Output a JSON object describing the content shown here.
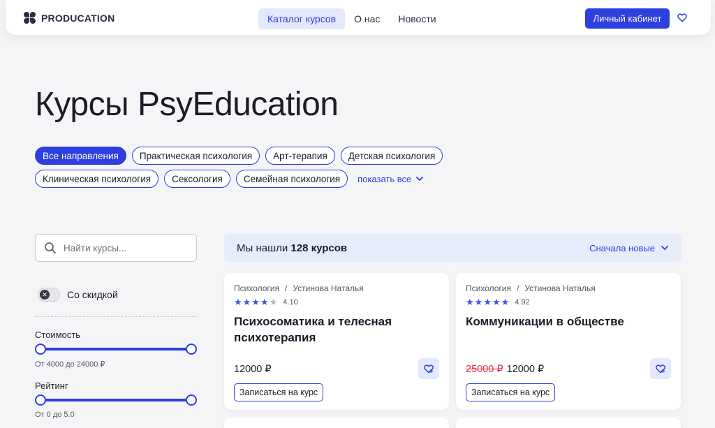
{
  "header": {
    "logo_text": "PRODUCATION",
    "nav": [
      {
        "label": "Каталог курсов",
        "active": true
      },
      {
        "label": "О нас",
        "active": false
      },
      {
        "label": "Новости",
        "active": false
      }
    ],
    "cabinet_label": "Личный кабинет",
    "accent_color": "#2e3fe0"
  },
  "page_title": "Курсы PsyEducation",
  "tags_row1": [
    {
      "label": "Все направления",
      "active": true
    },
    {
      "label": "Практическая психология",
      "active": false
    },
    {
      "label": "Арт-терапия",
      "active": false
    },
    {
      "label": "Детская психология",
      "active": false
    }
  ],
  "tags_row2": [
    {
      "label": "Клиническая психология",
      "active": false
    },
    {
      "label": "Сексология",
      "active": false
    },
    {
      "label": "Семейная психология",
      "active": false
    }
  ],
  "show_all_label": "показать все",
  "sidebar": {
    "search_placeholder": "Найти курсы...",
    "discount_label": "Со скидкой",
    "discount_on": false,
    "price_label": "Стоимость",
    "price_range": "От 4000 до 24000 ₽",
    "rating_label": "Рейтинг",
    "rating_range": "От 0 до 5.0"
  },
  "results": {
    "count_prefix": "Мы нашли",
    "count_value": "128 курсов",
    "sort_label": "Сначала новые"
  },
  "cards": [
    {
      "category": "Психология",
      "separator": "/",
      "author": "Устинова Наталья",
      "rating": "4.10",
      "stars_filled": 4,
      "title": "Психосоматика и телесная психотерапия",
      "old_price": "",
      "price": "12000 ₽",
      "enroll_label": "Записаться на курс"
    },
    {
      "category": "Психология",
      "separator": "/",
      "author": "Устинова Наталья",
      "rating": "4.92",
      "stars_filled": 5,
      "title": "Коммуникации в обществе",
      "old_price": "25000 ₽",
      "price": "12000 ₽",
      "enroll_label": "Записаться на курс"
    }
  ]
}
